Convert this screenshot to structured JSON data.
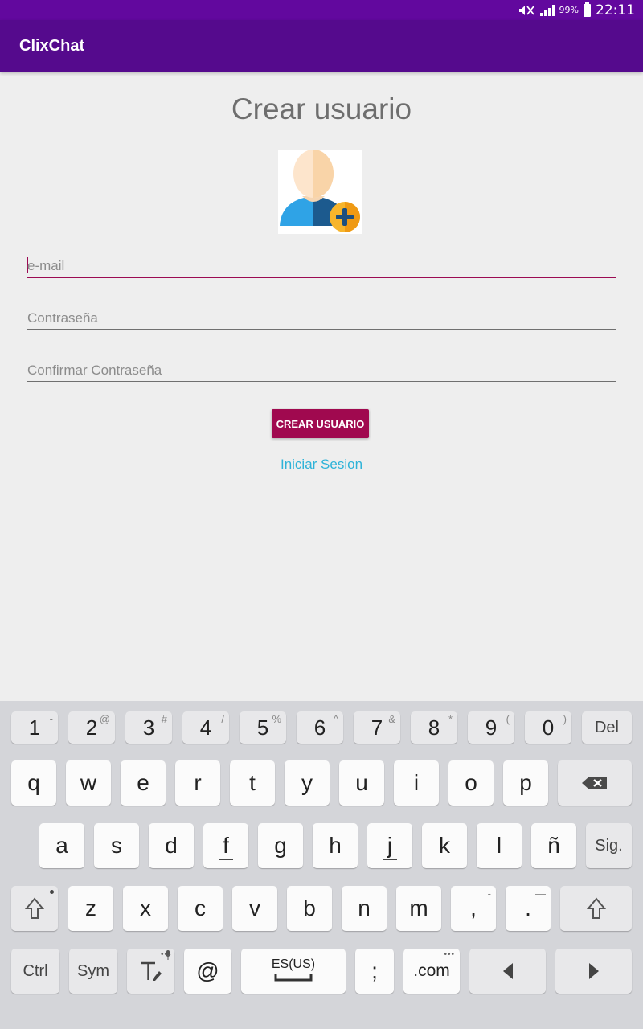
{
  "status_bar": {
    "battery": "99%",
    "time": "22:11"
  },
  "app_bar": {
    "title": "ClixChat"
  },
  "form": {
    "title": "Crear usuario",
    "email_placeholder": "e-mail",
    "password_placeholder": "Contraseña",
    "confirm_placeholder": "Confirmar Contraseña",
    "create_button": "CREAR USUARIO",
    "login_link": "Iniciar Sesion"
  },
  "colors": {
    "status_bar": "#62089e",
    "app_bar": "#550a8d",
    "accent": "#a0094f",
    "link": "#2eb3d8"
  },
  "keyboard": {
    "row_numbers": [
      {
        "main": "1",
        "alt": "-"
      },
      {
        "main": "2",
        "alt": "@"
      },
      {
        "main": "3",
        "alt": "#"
      },
      {
        "main": "4",
        "alt": "/"
      },
      {
        "main": "5",
        "alt": "%"
      },
      {
        "main": "6",
        "alt": "^"
      },
      {
        "main": "7",
        "alt": "&"
      },
      {
        "main": "8",
        "alt": "*"
      },
      {
        "main": "9",
        "alt": "("
      },
      {
        "main": "0",
        "alt": ")"
      }
    ],
    "del": "Del",
    "row1": [
      "q",
      "w",
      "e",
      "r",
      "t",
      "y",
      "u",
      "i",
      "o",
      "p"
    ],
    "row2": [
      "a",
      "s",
      "d",
      "f",
      "g",
      "h",
      "j",
      "k",
      "l",
      "ñ"
    ],
    "sig": "Sig.",
    "row3": [
      "z",
      "x",
      "c",
      "v",
      "b",
      "n",
      "m"
    ],
    "comma": ",",
    "comma_alt": "-",
    "period": ".",
    "period_alt": "—",
    "ctrl": "Ctrl",
    "sym": "Sym",
    "at": "@",
    "space_lang": "ES(US)",
    "semicolon": ";",
    "dotcom": ".com"
  }
}
